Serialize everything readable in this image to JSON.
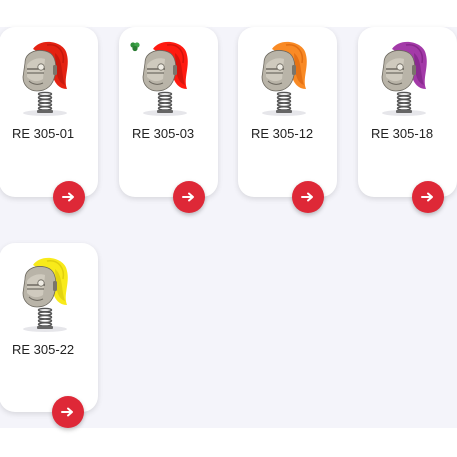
{
  "products": [
    {
      "code": "RE 305-01",
      "mane_color": "#e42212",
      "mane_shade": "#b8140a",
      "has_badge": false,
      "image_icon": "spring-rider-knight-helmet-red",
      "button_icon": "arrow-right-icon"
    },
    {
      "code": "RE 305-03",
      "mane_color": "#ff1a10",
      "mane_shade": "#c01008",
      "has_badge": true,
      "image_icon": "spring-rider-knight-helmet-red-eco",
      "button_icon": "arrow-right-icon"
    },
    {
      "code": "RE 305-12",
      "mane_color": "#f98a25",
      "mane_shade": "#d9620a",
      "has_badge": false,
      "image_icon": "spring-rider-knight-helmet-orange",
      "button_icon": "arrow-right-icon"
    },
    {
      "code": "RE 305-18",
      "mane_color": "#a33aa8",
      "mane_shade": "#7a2080",
      "has_badge": false,
      "image_icon": "spring-rider-knight-helmet-purple",
      "button_icon": "arrow-right-icon"
    },
    {
      "code": "RE 305-22",
      "mane_color": "#f8ea1a",
      "mane_shade": "#d6c40a",
      "has_badge": false,
      "image_icon": "spring-rider-knight-helmet-yellow",
      "button_icon": "arrow-right-icon"
    }
  ],
  "colors": {
    "button": "#de2837",
    "background": "#f4f4fa",
    "card": "#ffffff"
  }
}
